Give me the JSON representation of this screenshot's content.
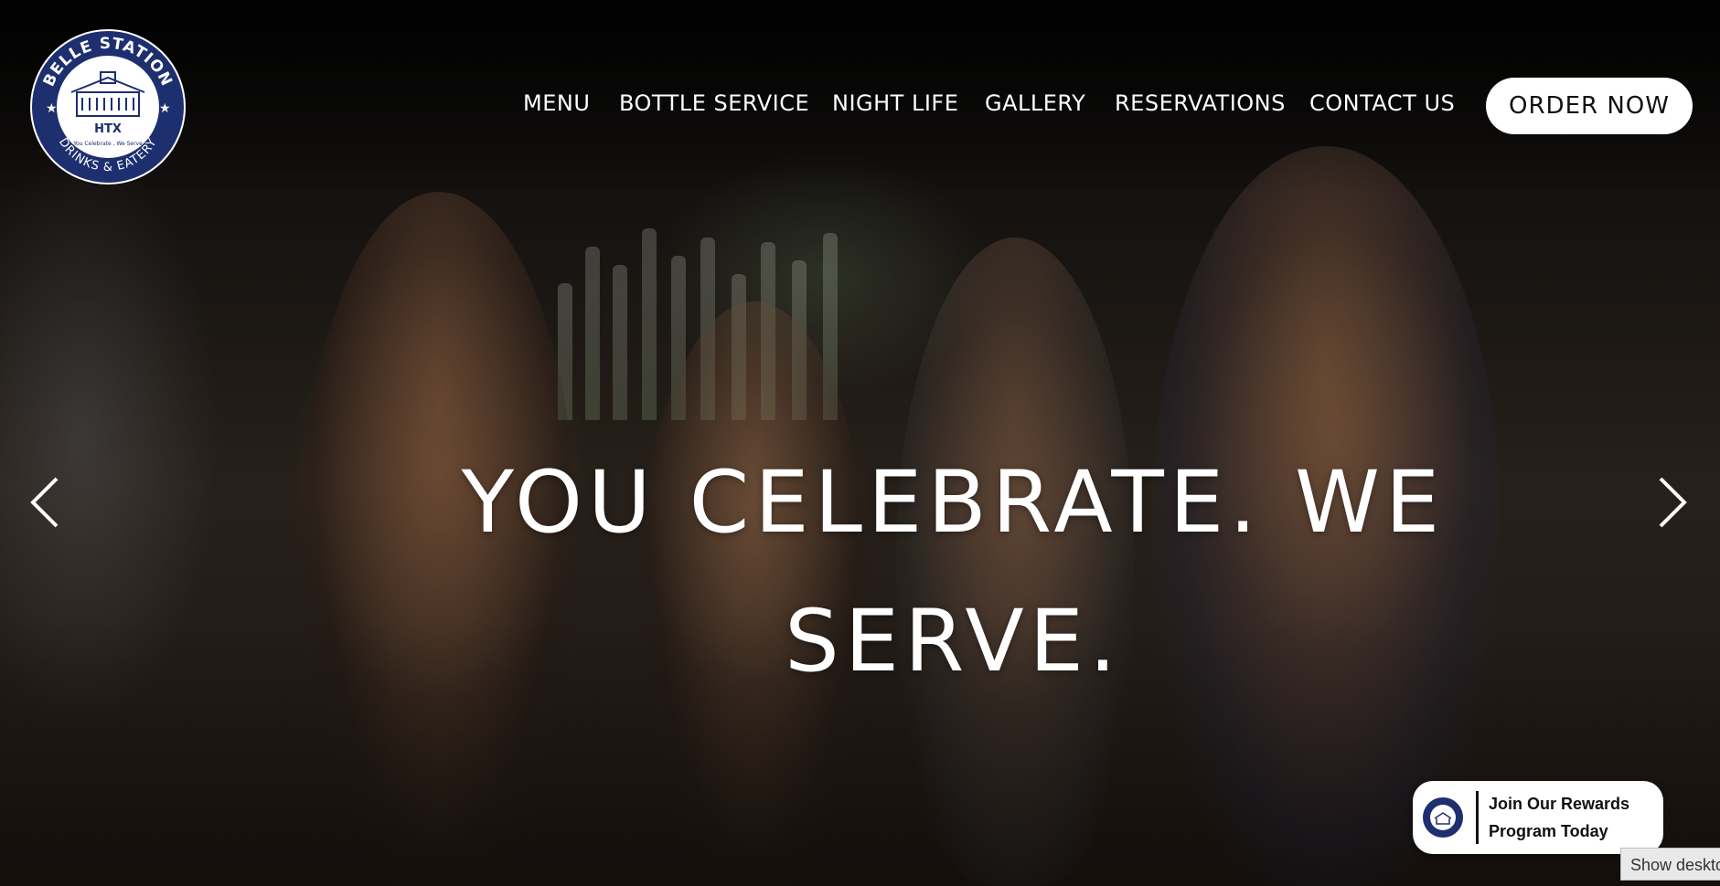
{
  "logo": {
    "top_text": "BELLE STATION",
    "middle_text": "HTX",
    "tagline": "You Celebrate , We Serve",
    "bottom_text": "DRINKS & EATERY"
  },
  "nav": {
    "items": [
      "MENU",
      "BOTTLE SERVICE",
      "NIGHT LIFE",
      "GALLERY",
      "RESERVATIONS",
      "CONTACT US"
    ],
    "cta_label": "ORDER NOW"
  },
  "hero": {
    "headline_line1": "YOU CELEBRATE. WE",
    "headline_line2": "SERVE."
  },
  "carousel": {
    "prev_icon": "chevron-left-icon",
    "next_icon": "chevron-right-icon"
  },
  "rewards": {
    "line1": "Join Our Rewards",
    "line2": "Program Today"
  },
  "tooltip": {
    "label": "Show desktop"
  },
  "colors": {
    "logo_navy": "#1d2f6f",
    "button_bg": "#ffffff",
    "text_white": "#ffffff"
  }
}
